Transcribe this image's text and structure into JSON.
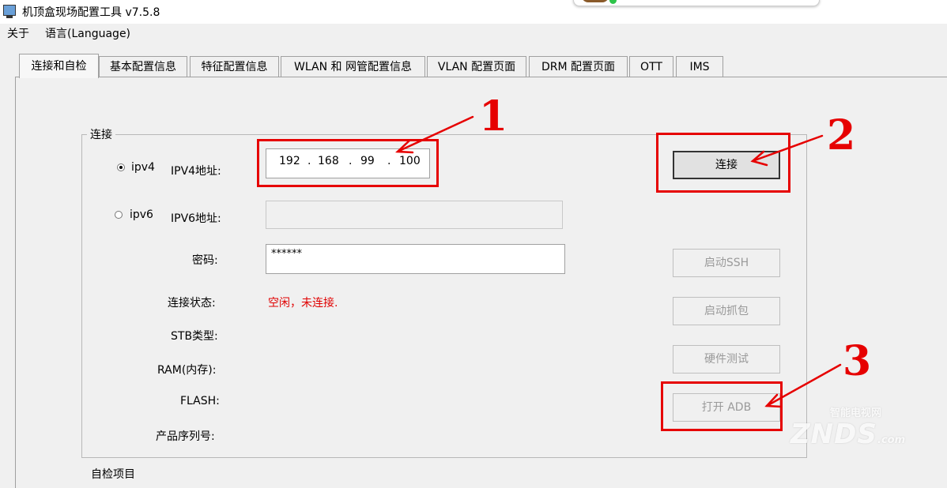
{
  "window": {
    "title": "机顶盒现场配置工具 v7.5.8",
    "icon": "monitor-icon"
  },
  "menu": {
    "items": [
      "关于",
      "语言(Language)"
    ]
  },
  "tabs": [
    {
      "label": "连接和自检",
      "active": true
    },
    {
      "label": "基本配置信息"
    },
    {
      "label": "特征配置信息"
    },
    {
      "label": "WLAN 和 网管配置信息"
    },
    {
      "label": "VLAN 配置页面"
    },
    {
      "label": "DRM 配置页面"
    },
    {
      "label": "OTT"
    },
    {
      "label": "IMS"
    }
  ],
  "connect": {
    "group_title": "连接",
    "ipv4": {
      "radio_label": "ipv4",
      "field_label": "IPV4地址:",
      "selected": true,
      "octets": [
        "192",
        "168",
        "99",
        "100"
      ],
      "dot": "."
    },
    "ipv6": {
      "radio_label": "ipv6",
      "field_label": "IPV6地址:",
      "selected": false,
      "value": ""
    },
    "password": {
      "label": "密码:",
      "value": "******"
    },
    "status": {
      "label": "连接状态:",
      "value": "空闲，未连接.",
      "color": "#e00000"
    },
    "stb_type": {
      "label": "STB类型:",
      "value": ""
    },
    "ram": {
      "label": "RAM(内存):",
      "value": ""
    },
    "flash": {
      "label": "FLASH:",
      "value": ""
    },
    "serial": {
      "label": "产品序列号:",
      "value": ""
    }
  },
  "buttons": {
    "connect": "连接",
    "ssh": "启动SSH",
    "capture": "启动抓包",
    "hardware_test": "硬件测试",
    "open_adb": "打开 ADB"
  },
  "bottom_group_title": "自检项目",
  "annotations": {
    "color": "#e60000",
    "numbers": [
      "1",
      "2",
      "3"
    ]
  },
  "watermark": {
    "main": "ZNDS",
    "sub": "智能电视网",
    "domain": ".com"
  }
}
